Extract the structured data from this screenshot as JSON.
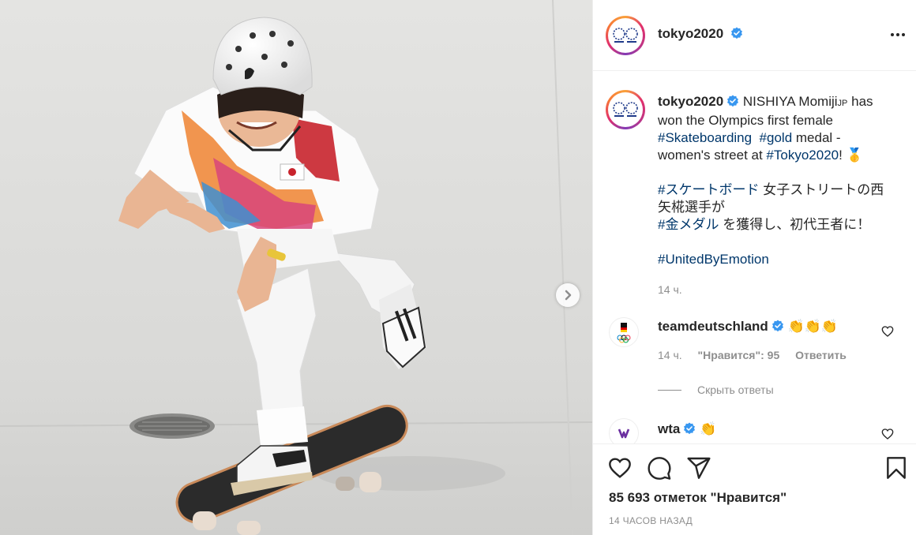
{
  "post": {
    "account": "tokyo2020",
    "more_label": "More options"
  },
  "caption": {
    "author": "tokyo2020",
    "line1_a": " NISHIYA Momiji",
    "line1_sup": "JP",
    "line1_b": " has",
    "line2": "won the Olympics first female",
    "tag_skateboarding": "#Skateboarding",
    "tag_gold": "#gold",
    "line3_rest": " medal -",
    "line4_a": "women's street at ",
    "tag_tokyo": "#Tokyo2020",
    "line4_b": "! ",
    "medal_emoji": "🥇",
    "jp_tag1": "#スケートボード",
    "jp_line1_rest": " 女子ストリートの西",
    "jp_line2_a": "矢椛選手が",
    "jp_tag2": "#金メダル",
    "jp_line3_rest": " を獲得し、初代王者に！",
    "tag_united": "#UnitedByEmotion",
    "time": "14 ч."
  },
  "comments": [
    {
      "author": "teamdeutschland",
      "text": "👏👏👏",
      "time": "14 ч.",
      "likes": "\"Нравится\": 95",
      "reply": "Ответить"
    },
    {
      "author": "wta",
      "text": "👏"
    }
  ],
  "hide_replies": "Скрыть ответы",
  "likes_count": "85 693 отметок \"Нравится\"",
  "posted_ago": "14 ЧАСОВ НАЗАД",
  "colors": {
    "link": "#00376b",
    "verified": "#3897f0",
    "muted": "#8e8e8e"
  }
}
